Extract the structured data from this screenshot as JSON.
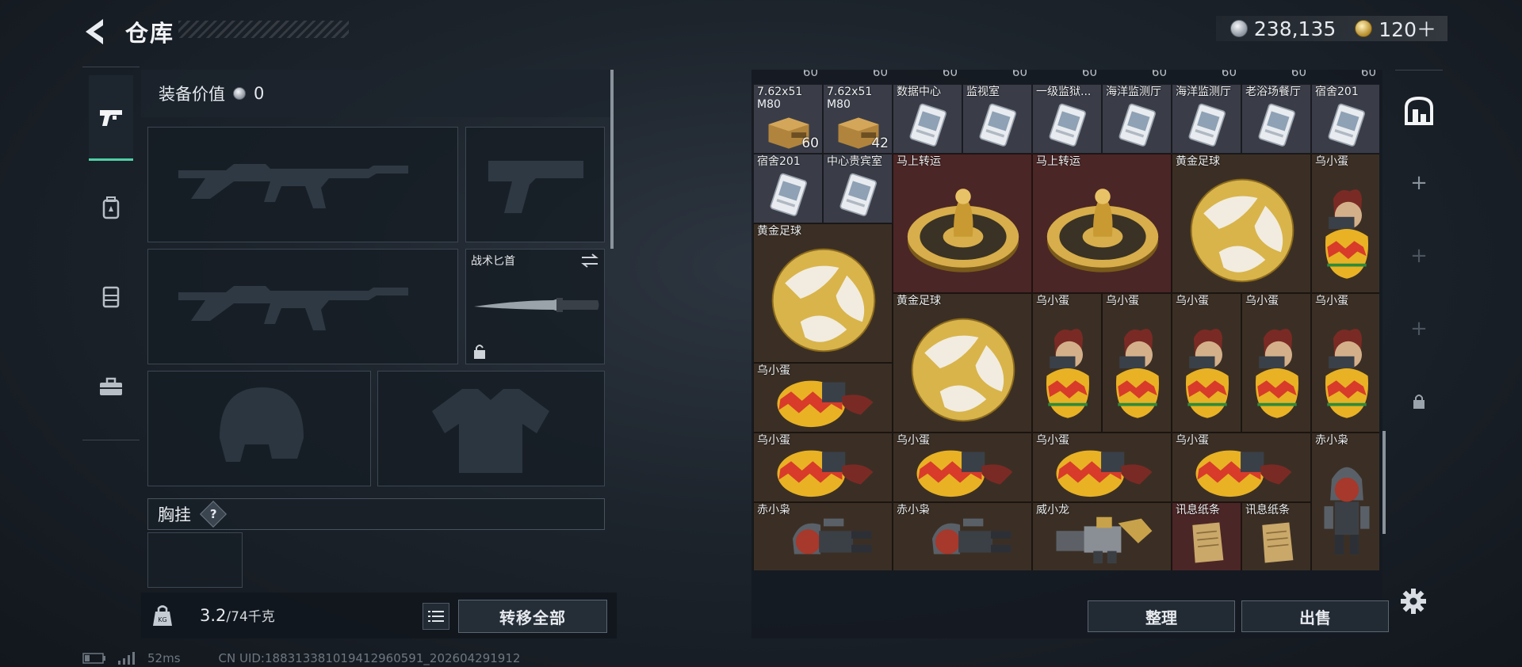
{
  "header": {
    "title": "仓库"
  },
  "currency": {
    "silver": "238,135",
    "gold": "120＋"
  },
  "side_tabs": [
    "weapon-tab-icon",
    "backpack-tab-icon",
    "locker-tab-icon",
    "briefcase-tab-icon"
  ],
  "loadout": {
    "value_label": "装备价值",
    "value": "0",
    "melee_label": "战术匕首",
    "chest_label": "胸挂",
    "chest_help": "?",
    "weight_current": "3.2",
    "weight_max": "/74千克",
    "transfer_label": "转移全部"
  },
  "storage": {
    "top_qty": [
      "60",
      "60",
      "60",
      "60",
      "60",
      "60",
      "60",
      "60",
      "60"
    ],
    "cells": [
      {
        "name": "7.62x51",
        "name2": "M80",
        "qty": "60",
        "kind": "ammo",
        "bg": "silver",
        "col": 0,
        "row": 0,
        "w": 1,
        "h": 1
      },
      {
        "name": "7.62x51",
        "name2": "M80",
        "qty": "42",
        "kind": "ammo",
        "bg": "silver",
        "col": 1,
        "row": 0,
        "w": 1,
        "h": 1
      },
      {
        "name": "数据中心",
        "kind": "card",
        "bg": "silver",
        "col": 2,
        "row": 0,
        "w": 1,
        "h": 1
      },
      {
        "name": "监视室",
        "kind": "card",
        "bg": "silver",
        "col": 3,
        "row": 0,
        "w": 1,
        "h": 1
      },
      {
        "name": "一级监狱...",
        "kind": "card",
        "bg": "silver",
        "col": 4,
        "row": 0,
        "w": 1,
        "h": 1
      },
      {
        "name": "海洋监测厅",
        "kind": "card",
        "bg": "silver",
        "col": 5,
        "row": 0,
        "w": 1,
        "h": 1
      },
      {
        "name": "海洋监测厅",
        "kind": "card",
        "bg": "silver",
        "col": 6,
        "row": 0,
        "w": 1,
        "h": 1
      },
      {
        "name": "老浴场餐厅",
        "kind": "card",
        "bg": "silver",
        "col": 7,
        "row": 0,
        "w": 1,
        "h": 1
      },
      {
        "name": "宿舍201",
        "kind": "card",
        "bg": "silver",
        "col": 8,
        "row": 0,
        "w": 1,
        "h": 1
      },
      {
        "name": "宿舍201",
        "kind": "card",
        "bg": "silver",
        "col": 0,
        "row": 1,
        "w": 1,
        "h": 1
      },
      {
        "name": "中心贵宾室",
        "kind": "card",
        "bg": "silver",
        "col": 1,
        "row": 1,
        "w": 1,
        "h": 1
      },
      {
        "name": "马上转运",
        "kind": "wheel",
        "bg": "red",
        "col": 2,
        "row": 1,
        "w": 2,
        "h": 2
      },
      {
        "name": "马上转运",
        "kind": "wheel",
        "bg": "red",
        "col": 4,
        "row": 1,
        "w": 2,
        "h": 2
      },
      {
        "name": "黄金足球",
        "kind": "ball",
        "bg": "brown",
        "col": 6,
        "row": 1,
        "w": 2,
        "h": 2
      },
      {
        "name": "乌小蛋",
        "kind": "egg",
        "bg": "brown",
        "col": 8,
        "row": 1,
        "w": 1,
        "h": 2
      },
      {
        "name": "黄金足球",
        "kind": "ball",
        "bg": "brown",
        "col": 0,
        "row": 2,
        "w": 2,
        "h": 2
      },
      {
        "name": "黄金足球",
        "kind": "ball",
        "bg": "brown",
        "col": 2,
        "row": 3,
        "w": 2,
        "h": 2
      },
      {
        "name": "乌小蛋",
        "kind": "egg",
        "bg": "brown",
        "col": 4,
        "row": 3,
        "w": 1,
        "h": 2
      },
      {
        "name": "乌小蛋",
        "kind": "egg",
        "bg": "brown",
        "col": 5,
        "row": 3,
        "w": 1,
        "h": 2
      },
      {
        "name": "乌小蛋",
        "kind": "egg",
        "bg": "brown",
        "col": 6,
        "row": 3,
        "w": 1,
        "h": 2
      },
      {
        "name": "乌小蛋",
        "kind": "egg",
        "bg": "brown",
        "col": 7,
        "row": 3,
        "w": 1,
        "h": 2
      },
      {
        "name": "乌小蛋",
        "kind": "egg",
        "bg": "brown",
        "col": 8,
        "row": 3,
        "w": 1,
        "h": 2
      },
      {
        "name": "乌小蛋",
        "kind": "egg-side",
        "bg": "brown",
        "col": 0,
        "row": 4,
        "w": 2,
        "h": 1
      },
      {
        "name": "乌小蛋",
        "kind": "egg-side",
        "bg": "brown",
        "col": 0,
        "row": 5,
        "w": 2,
        "h": 1
      },
      {
        "name": "乌小蛋",
        "kind": "egg-side",
        "bg": "brown",
        "col": 2,
        "row": 5,
        "w": 2,
        "h": 1
      },
      {
        "name": "乌小蛋",
        "kind": "egg-side",
        "bg": "brown",
        "col": 4,
        "row": 5,
        "w": 2,
        "h": 1
      },
      {
        "name": "乌小蛋",
        "kind": "egg-side",
        "bg": "brown",
        "col": 6,
        "row": 5,
        "w": 2,
        "h": 1
      },
      {
        "name": "赤小枭",
        "kind": "figure",
        "bg": "brown",
        "col": 8,
        "row": 5,
        "w": 1,
        "h": 2
      },
      {
        "name": "赤小枭",
        "kind": "figure-side",
        "bg": "brown",
        "col": 0,
        "row": 6,
        "w": 2,
        "h": 1
      },
      {
        "name": "赤小枭",
        "kind": "figure-side",
        "bg": "brown",
        "col": 2,
        "row": 6,
        "w": 2,
        "h": 1
      },
      {
        "name": "威小龙",
        "kind": "figure-side-gold",
        "bg": "brown",
        "col": 4,
        "row": 6,
        "w": 2,
        "h": 1
      },
      {
        "name": "讯息纸条",
        "kind": "note",
        "bg": "red",
        "col": 6,
        "row": 6,
        "w": 1,
        "h": 1
      },
      {
        "name": "讯息纸条",
        "kind": "note",
        "bg": "brown",
        "col": 7,
        "row": 6,
        "w": 1,
        "h": 1
      }
    ],
    "sort_label": "整理",
    "sell_label": "出售"
  },
  "right_col": [
    "hideout-icon",
    "plus-icon",
    "plus-icon",
    "plus-icon",
    "lock-icon"
  ],
  "status": {
    "ping": "52ms",
    "uid": "CN UID:188313381019412960591_202604291912"
  },
  "colors": {
    "accent_green": "#4fd0a5",
    "silver_cell": "#3a3d48",
    "red_cell": "#4b2626",
    "brown_cell": "#3b2f25"
  }
}
